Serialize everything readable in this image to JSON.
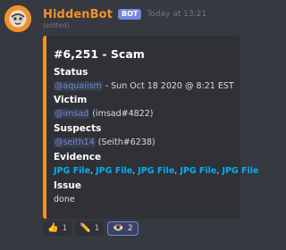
{
  "message": {
    "username": "HiddenBot",
    "bot_tag": "BOT",
    "timestamp": "Today at 13:21",
    "edited": "(edited)"
  },
  "embed": {
    "title": "#6,251 - Scam",
    "accent_color": "#f0922b",
    "status": {
      "name": "Status",
      "mention": "@aquaiism",
      "text": " - Sun Oct 18 2020 @ 8:21 EST"
    },
    "victim": {
      "name": "Victim",
      "mention": "@imsad",
      "text": " (imsad#4822)"
    },
    "suspects": {
      "name": "Suspects",
      "mention": "@seith14",
      "text": " (Seith#6238)"
    },
    "evidence": {
      "name": "Evidence",
      "links": [
        "JPG File",
        "JPG File",
        "JPG File",
        "JPG File",
        "JPG File"
      ],
      "separator": ", "
    },
    "issue": {
      "name": "Issue",
      "value": "done"
    }
  },
  "reactions": [
    {
      "emoji": "thumbs-up",
      "glyph": "👍",
      "count": "1"
    },
    {
      "emoji": "pencil",
      "glyph": "✏️",
      "count": "1"
    },
    {
      "emoji": "eye",
      "glyph": "👁️",
      "count": "2"
    }
  ]
}
